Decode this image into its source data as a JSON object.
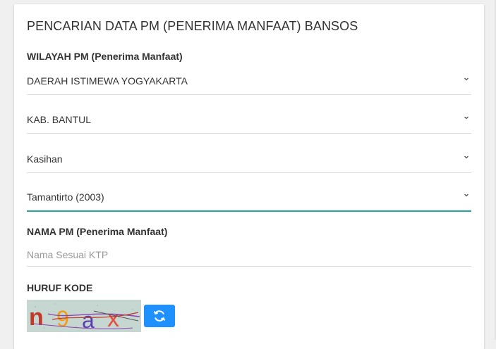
{
  "page_title": "PENCARIAN DATA PM (PENERIMA MANFAAT) BANSOS",
  "wilayah": {
    "label": "WILAYAH PM (Penerima Manfaat)",
    "province": "DAERAH ISTIMEWA YOGYAKARTA",
    "regency": "KAB. BANTUL",
    "district": "Kasihan",
    "village": "Tamantirto (2003)"
  },
  "nama": {
    "label": "NAMA PM (Penerima Manfaat)",
    "placeholder": "Nama Sesuai KTP",
    "value": ""
  },
  "kode": {
    "label": "HURUF KODE",
    "captcha_text": "n9ax",
    "refresh_icon": "refresh-icon"
  },
  "colors": {
    "accent": "#26a69a",
    "button": "#1e90ff"
  }
}
